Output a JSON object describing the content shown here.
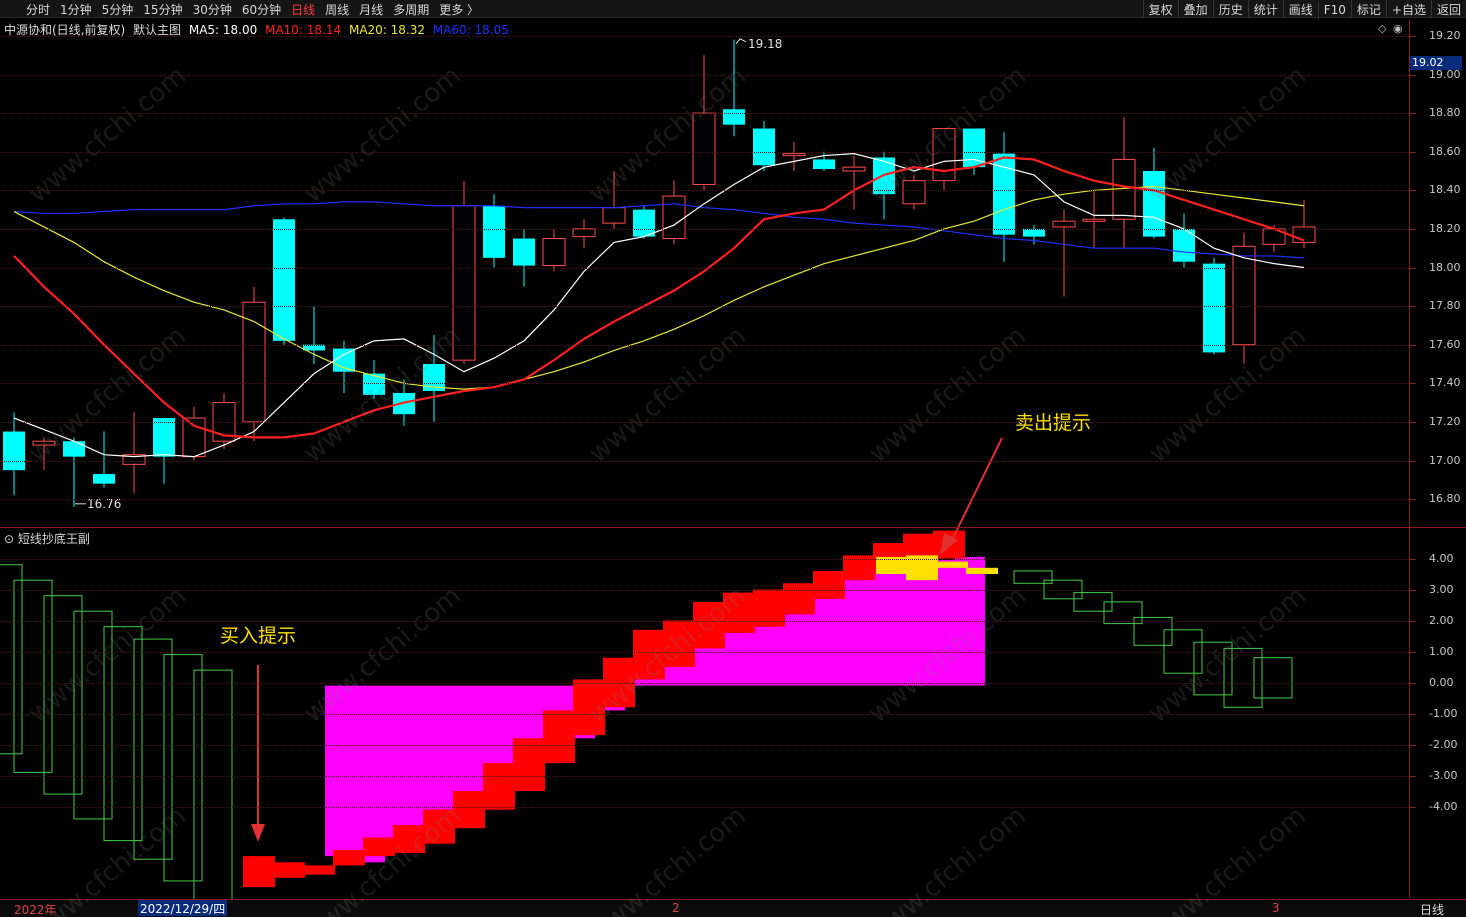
{
  "toolbar": {
    "periods": [
      "分时",
      "1分钟",
      "5分钟",
      "15分钟",
      "30分钟",
      "60分钟",
      "日线",
      "周线",
      "月线",
      "多周期",
      "更多 〉"
    ],
    "active_period": "日线",
    "right_tools": [
      "复权",
      "叠加",
      "历史",
      "统计",
      "画线",
      "F10",
      "标记",
      "+自选",
      "返回"
    ]
  },
  "header": {
    "stock": "中源协和(日线,前复权)",
    "template": "默认主图",
    "ma5": "MA5: 18.00",
    "ma10": "MA10: 18.14",
    "ma20": "MA20: 18.32",
    "ma60": "MA60: 18.05"
  },
  "colors": {
    "up": "#ff4d4d",
    "down": "#00ffff",
    "ma5": "#ffffff",
    "ma10": "#ff2020",
    "ma20": "#e8e830",
    "ma60": "#2030ff",
    "magenta": "#ff00ff",
    "red": "#ff0000",
    "yellow": "#ffe000",
    "green": "#44cc44"
  },
  "price_axis": [
    "19.20",
    "19.00",
    "18.80",
    "18.60",
    "18.40",
    "18.20",
    "18.00",
    "17.80",
    "17.60",
    "17.40",
    "17.20",
    "17.00",
    "16.80"
  ],
  "last_price": "19.02",
  "high_label": "19.18",
  "low_label": "16.76",
  "sub_indicator": {
    "title": "短线抄底王副",
    "axis": [
      "4.00",
      "3.00",
      "2.00",
      "1.00",
      "0.00",
      "-1.00",
      "-2.00",
      "-3.00",
      "-4.00"
    ]
  },
  "annotations": {
    "buy": "买入提示",
    "sell": "卖出提示"
  },
  "x_axis": {
    "year": "2022年",
    "date": "2022/12/29/四",
    "m2": "2",
    "m3": "3",
    "period": "日线"
  },
  "watermark": "www.cfchi.com",
  "chart_data": {
    "type": "candlestick",
    "candles": [
      {
        "o": 17.15,
        "h": 17.25,
        "l": 16.82,
        "c": 16.95
      },
      {
        "o": 17.08,
        "h": 17.12,
        "l": 16.95,
        "c": 17.1
      },
      {
        "o": 17.1,
        "h": 17.12,
        "l": 16.76,
        "c": 17.02
      },
      {
        "o": 16.93,
        "h": 17.15,
        "l": 16.86,
        "c": 16.88
      },
      {
        "o": 16.98,
        "h": 17.25,
        "l": 16.83,
        "c": 17.03
      },
      {
        "o": 17.22,
        "h": 17.22,
        "l": 16.88,
        "c": 17.02
      },
      {
        "o": 17.02,
        "h": 17.28,
        "l": 17.0,
        "c": 17.22
      },
      {
        "o": 17.1,
        "h": 17.35,
        "l": 17.06,
        "c": 17.3
      },
      {
        "o": 17.2,
        "h": 17.9,
        "l": 17.1,
        "c": 17.82
      },
      {
        "o": 18.25,
        "h": 18.26,
        "l": 17.6,
        "c": 17.62
      },
      {
        "o": 17.6,
        "h": 17.8,
        "l": 17.5,
        "c": 17.57
      },
      {
        "o": 17.58,
        "h": 17.62,
        "l": 17.35,
        "c": 17.46
      },
      {
        "o": 17.45,
        "h": 17.52,
        "l": 17.32,
        "c": 17.34
      },
      {
        "o": 17.35,
        "h": 17.42,
        "l": 17.18,
        "c": 17.24
      },
      {
        "o": 17.5,
        "h": 17.65,
        "l": 17.2,
        "c": 17.36
      },
      {
        "o": 17.52,
        "h": 18.45,
        "l": 17.5,
        "c": 18.32
      },
      {
        "o": 18.32,
        "h": 18.38,
        "l": 18.0,
        "c": 18.05
      },
      {
        "o": 18.15,
        "h": 18.2,
        "l": 17.9,
        "c": 18.01
      },
      {
        "o": 18.01,
        "h": 18.2,
        "l": 17.98,
        "c": 18.15
      },
      {
        "o": 18.16,
        "h": 18.25,
        "l": 18.1,
        "c": 18.2
      },
      {
        "o": 18.23,
        "h": 18.5,
        "l": 18.2,
        "c": 18.31
      },
      {
        "o": 18.3,
        "h": 18.32,
        "l": 18.15,
        "c": 18.16
      },
      {
        "o": 18.15,
        "h": 18.45,
        "l": 18.12,
        "c": 18.37
      },
      {
        "o": 18.43,
        "h": 19.1,
        "l": 18.4,
        "c": 18.8
      },
      {
        "o": 18.82,
        "h": 19.18,
        "l": 18.68,
        "c": 18.74
      },
      {
        "o": 18.72,
        "h": 18.76,
        "l": 18.5,
        "c": 18.53
      },
      {
        "o": 18.58,
        "h": 18.65,
        "l": 18.5,
        "c": 18.59
      },
      {
        "o": 18.56,
        "h": 18.6,
        "l": 18.5,
        "c": 18.51
      },
      {
        "o": 18.5,
        "h": 18.58,
        "l": 18.3,
        "c": 18.52
      },
      {
        "o": 18.57,
        "h": 18.6,
        "l": 18.25,
        "c": 18.38
      },
      {
        "o": 18.33,
        "h": 18.48,
        "l": 18.3,
        "c": 18.45
      },
      {
        "o": 18.45,
        "h": 18.68,
        "l": 18.4,
        "c": 18.72
      },
      {
        "o": 18.72,
        "h": 18.7,
        "l": 18.48,
        "c": 18.52
      },
      {
        "o": 18.59,
        "h": 18.7,
        "l": 18.03,
        "c": 18.17
      },
      {
        "o": 18.2,
        "h": 18.22,
        "l": 18.12,
        "c": 18.16
      },
      {
        "o": 18.21,
        "h": 18.3,
        "l": 17.85,
        "c": 18.24
      },
      {
        "o": 18.24,
        "h": 18.4,
        "l": 18.1,
        "c": 18.25
      },
      {
        "o": 18.25,
        "h": 18.78,
        "l": 18.1,
        "c": 18.56
      },
      {
        "o": 18.5,
        "h": 18.62,
        "l": 18.15,
        "c": 18.16
      },
      {
        "o": 18.2,
        "h": 18.28,
        "l": 18.0,
        "c": 18.03
      },
      {
        "o": 18.02,
        "h": 18.05,
        "l": 17.55,
        "c": 17.56
      },
      {
        "o": 17.6,
        "h": 18.18,
        "l": 17.5,
        "c": 18.11
      },
      {
        "o": 18.12,
        "h": 18.22,
        "l": 18.08,
        "c": 18.2
      },
      {
        "o": 18.13,
        "h": 18.35,
        "l": 18.1,
        "c": 18.21
      }
    ],
    "ma5": [
      17.22,
      17.16,
      17.1,
      17.03,
      17.02,
      17.03,
      17.02,
      17.08,
      17.15,
      17.3,
      17.45,
      17.55,
      17.62,
      17.63,
      17.55,
      17.46,
      17.53,
      17.62,
      17.78,
      17.98,
      18.13,
      18.16,
      18.22,
      18.33,
      18.43,
      18.52,
      18.55,
      18.58,
      18.59,
      18.55,
      18.5,
      18.55,
      18.56,
      18.52,
      18.48,
      18.34,
      18.27,
      18.27,
      18.26,
      18.2,
      18.1,
      18.05,
      18.02,
      18.0
    ],
    "ma10": [
      18.06,
      17.9,
      17.76,
      17.6,
      17.45,
      17.3,
      17.18,
      17.13,
      17.12,
      17.12,
      17.14,
      17.2,
      17.26,
      17.3,
      17.33,
      17.36,
      17.38,
      17.42,
      17.52,
      17.63,
      17.72,
      17.8,
      17.88,
      17.98,
      18.1,
      18.25,
      18.28,
      18.3,
      18.4,
      18.48,
      18.52,
      18.5,
      18.52,
      18.57,
      18.56,
      18.5,
      18.45,
      18.42,
      18.4,
      18.35,
      18.3,
      18.25,
      18.2,
      18.14
    ],
    "ma20": [
      18.29,
      18.21,
      18.13,
      18.03,
      17.95,
      17.88,
      17.82,
      17.78,
      17.72,
      17.63,
      17.55,
      17.48,
      17.44,
      17.4,
      17.38,
      17.37,
      17.38,
      17.42,
      17.46,
      17.51,
      17.57,
      17.62,
      17.68,
      17.75,
      17.83,
      17.9,
      17.96,
      18.02,
      18.06,
      18.1,
      18.14,
      18.2,
      18.24,
      18.3,
      18.35,
      18.38,
      18.4,
      18.41,
      18.42,
      18.4,
      18.38,
      18.36,
      18.34,
      18.32
    ],
    "ma60": [
      18.29,
      18.28,
      18.28,
      18.29,
      18.3,
      18.3,
      18.3,
      18.3,
      18.32,
      18.33,
      18.33,
      18.34,
      18.34,
      18.33,
      18.32,
      18.32,
      18.32,
      18.31,
      18.31,
      18.31,
      18.31,
      18.32,
      18.33,
      18.31,
      18.3,
      18.28,
      18.26,
      18.25,
      18.23,
      18.22,
      18.21,
      18.19,
      18.17,
      18.15,
      18.14,
      18.12,
      18.1,
      18.1,
      18.1,
      18.08,
      18.07,
      18.06,
      18.06,
      18.05
    ],
    "sub": {
      "green_early": [
        {
          "t": 3.8,
          "b": -2.3
        },
        {
          "t": 3.3,
          "b": -2.9
        },
        {
          "t": 2.8,
          "b": -3.6
        },
        {
          "t": 2.3,
          "b": -4.4
        },
        {
          "t": 1.8,
          "b": -5.1
        },
        {
          "t": 1.4,
          "b": -5.7
        },
        {
          "t": 0.9,
          "b": -6.4
        },
        {
          "t": 0.4,
          "b": -7.0
        }
      ],
      "red": [
        {
          "t": -5.6,
          "b": -6.6
        },
        {
          "t": -5.8,
          "b": -6.3
        },
        {
          "t": -5.9,
          "b": -6.2
        },
        {
          "t": -5.4,
          "b": -5.9
        },
        {
          "t": -5.0,
          "b": -5.6
        },
        {
          "t": -4.6,
          "b": -5.5
        },
        {
          "t": -4.1,
          "b": -5.2
        },
        {
          "t": -3.5,
          "b": -4.7
        },
        {
          "t": -2.6,
          "b": -4.1
        },
        {
          "t": -1.8,
          "b": -3.5
        },
        {
          "t": -0.9,
          "b": -2.6
        },
        {
          "t": 0.1,
          "b": -1.7
        },
        {
          "t": 0.8,
          "b": -0.8
        },
        {
          "t": 1.7,
          "b": 0.1
        },
        {
          "t": 2.0,
          "b": 0.5
        },
        {
          "t": 2.6,
          "b": 1.1
        },
        {
          "t": 2.9,
          "b": 1.6
        },
        {
          "t": 3.0,
          "b": 1.8
        },
        {
          "t": 3.2,
          "b": 2.2
        },
        {
          "t": 3.6,
          "b": 2.7
        },
        {
          "t": 4.1,
          "b": 3.3
        },
        {
          "t": 4.5,
          "b": 3.5
        },
        {
          "t": 4.8,
          "b": 3.8
        },
        {
          "t": 4.9,
          "b": 4.0
        }
      ],
      "magenta": [
        {
          "t": -0.1,
          "b": -5.6
        },
        {
          "t": -0.1,
          "b": -5.8
        },
        {
          "t": -0.1,
          "b": -5.4
        },
        {
          "t": -0.1,
          "b": -5.0
        },
        {
          "t": -0.1,
          "b": -4.6
        },
        {
          "t": -0.1,
          "b": -4.1
        },
        {
          "t": -0.1,
          "b": -3.5
        },
        {
          "t": -0.1,
          "b": -2.6
        },
        {
          "t": -0.1,
          "b": -1.8
        },
        {
          "t": -0.1,
          "b": -0.9
        },
        {
          "t": 0.1,
          "b": -0.1
        },
        {
          "t": 0.8,
          "b": -0.1
        },
        {
          "t": 1.1,
          "b": -0.1
        },
        {
          "t": 1.6,
          "b": -0.1
        },
        {
          "t": 1.8,
          "b": -0.1
        },
        {
          "t": 2.2,
          "b": -0.1
        },
        {
          "t": 2.7,
          "b": -0.1
        },
        {
          "t": 3.3,
          "b": -0.1
        },
        {
          "t": 3.5,
          "b": -0.1
        },
        {
          "t": 3.8,
          "b": -0.1
        },
        {
          "t": 3.95,
          "b": -0.1
        },
        {
          "t": 4.05,
          "b": -0.1
        }
      ],
      "yellow": [
        {
          "t": 4.05,
          "b": 3.5
        },
        {
          "t": 4.1,
          "b": 3.3
        },
        {
          "t": 3.9,
          "b": 3.7
        },
        {
          "t": 3.7,
          "b": 3.5
        }
      ],
      "green_late": [
        {
          "t": 3.6,
          "b": 3.2
        },
        {
          "t": 3.3,
          "b": 2.7
        },
        {
          "t": 2.9,
          "b": 2.3
        },
        {
          "t": 2.6,
          "b": 1.9
        },
        {
          "t": 2.1,
          "b": 1.2
        },
        {
          "t": 1.7,
          "b": 0.3
        },
        {
          "t": 1.3,
          "b": -0.4
        },
        {
          "t": 1.1,
          "b": -0.8
        },
        {
          "t": 0.8,
          "b": -0.5
        }
      ]
    }
  }
}
